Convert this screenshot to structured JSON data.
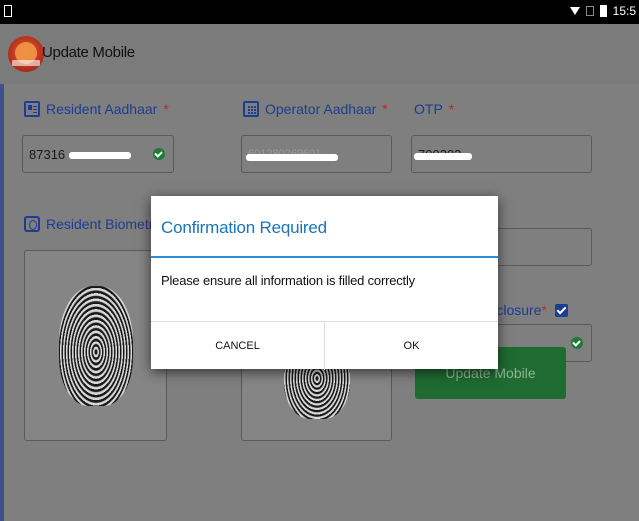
{
  "status_bar": {
    "time": "15:5",
    "wifi_icon": "wifi-icon",
    "signal_icon": "signal-icon",
    "battery_icon": "battery-icon"
  },
  "app_bar": {
    "title": "Update Mobile",
    "logo_icon": "aadhaar-logo-icon"
  },
  "form": {
    "resident_aadhaar": {
      "label": "Resident Aadhaar",
      "required_mark": "*",
      "value": "87316",
      "valid": true
    },
    "operator_aadhaar": {
      "label": "Operator Aadhaar",
      "required_mark": "*",
      "value": "601280269601"
    },
    "otp": {
      "label": "OTP",
      "required_mark": "*",
      "value": "700202"
    },
    "resident_biometric": {
      "label": "Resident Biometric"
    },
    "resident_disclosure": {
      "label": "Resident Disclosure",
      "required_mark": "*",
      "checked": true
    },
    "submit_label": "Update Mobile"
  },
  "dialog": {
    "title": "Confirmation Required",
    "message": "Please ensure all information is filled correctly",
    "cancel_label": "CANCEL",
    "ok_label": "OK"
  },
  "colors": {
    "accent_blue": "#1c3d92",
    "dialog_title": "#1c72b8",
    "button_green": "#1f6b32",
    "required_red": "#b23020"
  }
}
